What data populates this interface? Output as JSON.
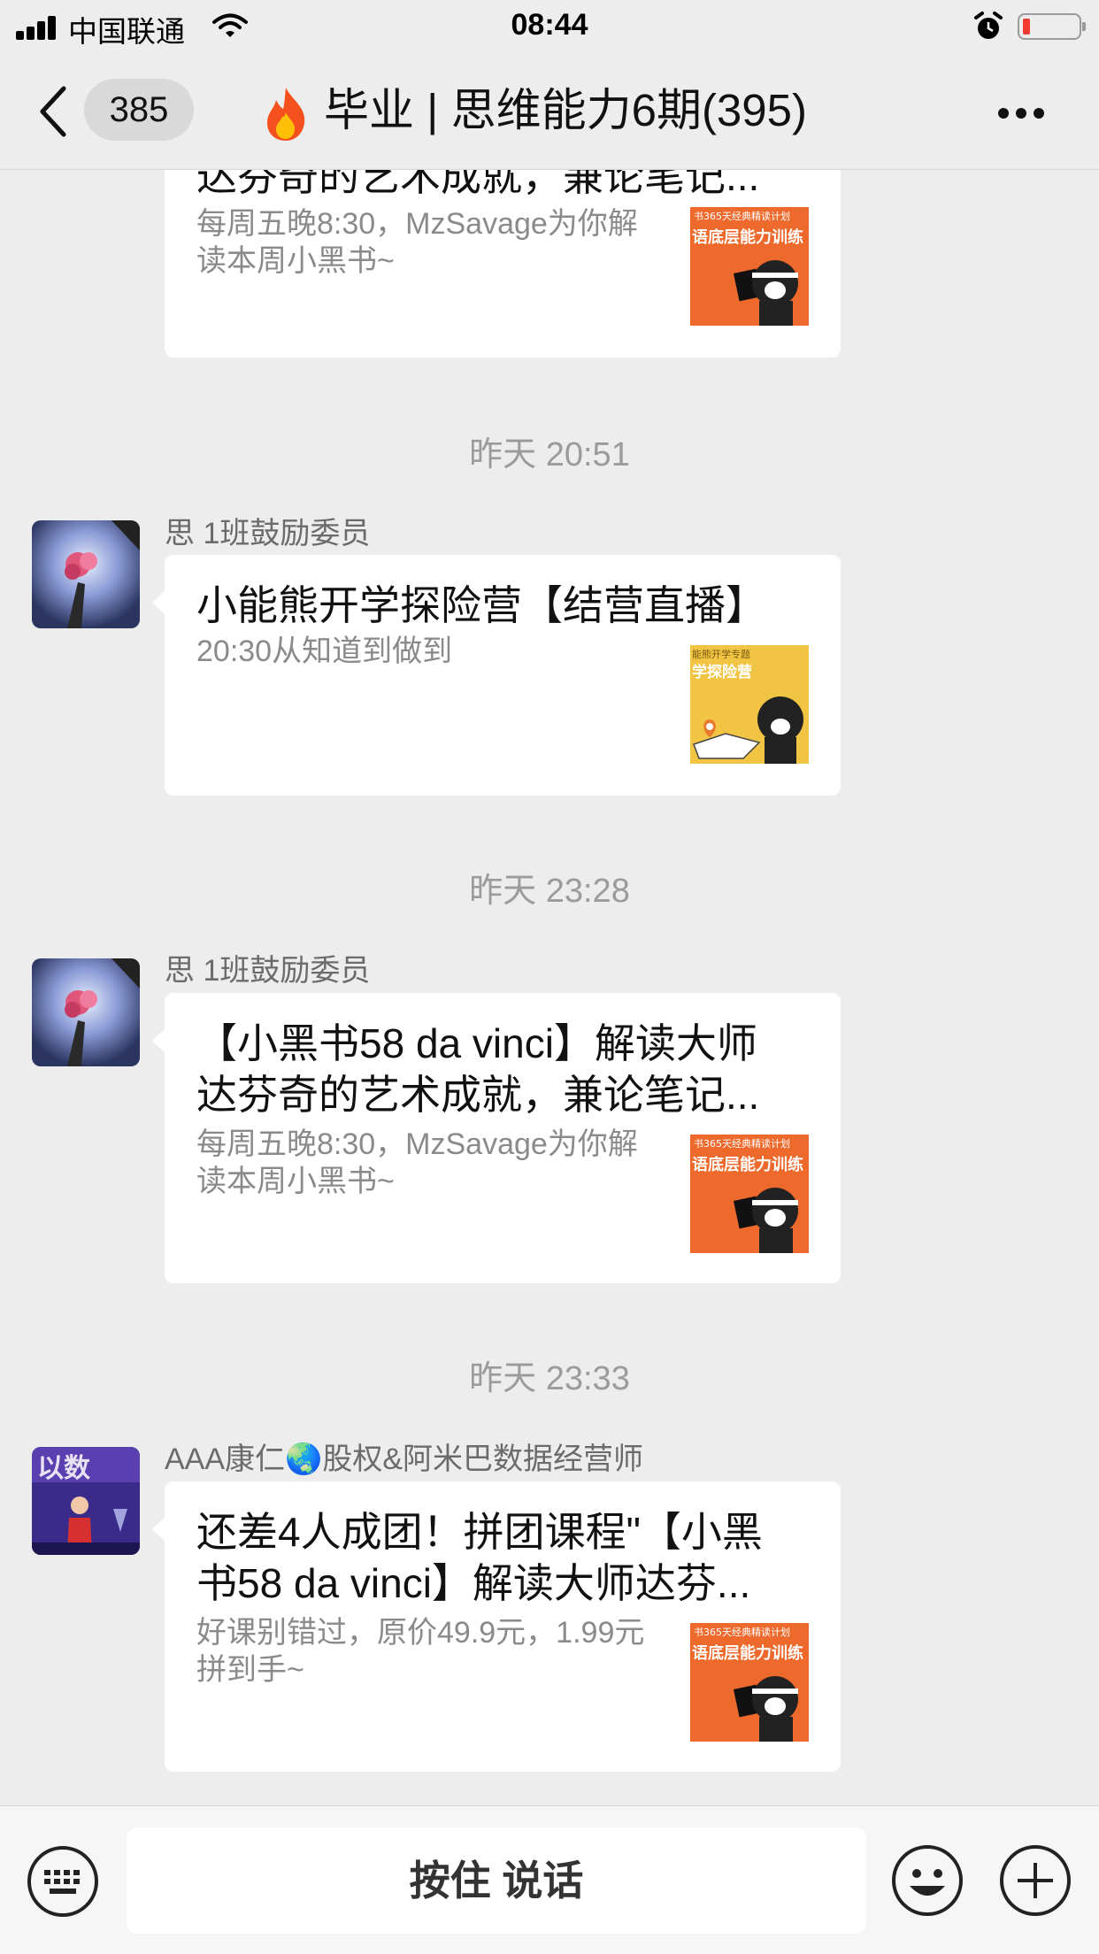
{
  "status_bar": {
    "carrier": "中国联通",
    "time": "08:44",
    "battery_color": "#f23b2f"
  },
  "nav": {
    "unread_count": "385",
    "title": "毕业 | 思维能力6期(395)",
    "title_icon": "fire-icon"
  },
  "messages": [
    {
      "type": "link-card",
      "title_lines": [
        "达芬奇的艺术成就，兼论笔记..."
      ],
      "desc": "每周五晚8:30，MzSavage为你解读本周小黑书~",
      "thumb": {
        "banner": "书365天经典精读计划",
        "text": "语底层能力训练",
        "color": "#ee6a2c"
      }
    },
    {
      "timestamp": "昨天 20:51",
      "sender": "思 1班鼓励委员",
      "title_lines": [
        "小能熊开学探险营【结营直播】"
      ],
      "desc": "20:30从知道到做到",
      "thumb": {
        "banner": "能熊开学专题",
        "text": "学探险营",
        "color": "#f2c443"
      }
    },
    {
      "timestamp": "昨天 23:28",
      "sender": "思 1班鼓励委员",
      "title_lines": [
        "【小黑书58 da vinci】解读大师",
        "达芬奇的艺术成就，兼论笔记..."
      ],
      "desc": "每周五晚8:30，MzSavage为你解读本周小黑书~",
      "thumb": {
        "banner": "书365天经典精读计划",
        "text": "语底层能力训练",
        "color": "#ee6a2c"
      }
    },
    {
      "timestamp": "昨天 23:33",
      "sender": "AAA康仁🌏股权&阿米巴数据经营师",
      "title_lines": [
        "还差4人成团！拼团课程\"【小黑",
        "书58 da vinci】解读大师达芬..."
      ],
      "desc": "好课别错过，原价49.9元，1.99元拼到手~",
      "thumb": {
        "banner": "书365天经典精读计划",
        "text": "语底层能力训练",
        "color": "#ee6a2c"
      }
    }
  ],
  "input_bar": {
    "voice_label": "按住 说话"
  }
}
